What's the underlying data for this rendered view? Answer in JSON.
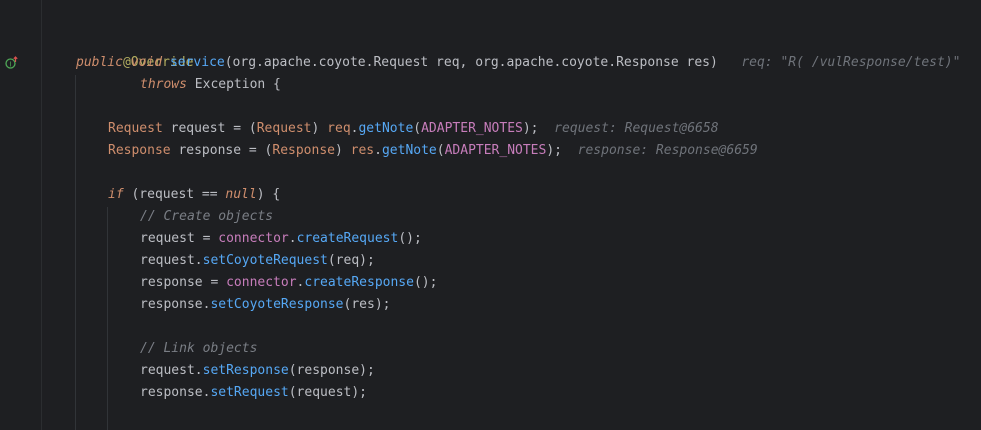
{
  "editor": {
    "colors": {
      "background": "#1e1f22",
      "annotation": "#b3ae60",
      "keyword": "#cf8e6d",
      "method": "#56a8f5",
      "field": "#c77dbb",
      "comment": "#7a7e85",
      "hint": "#6f737a",
      "text": "#bcbec4",
      "gutter_marker": "#4fa857"
    },
    "gutter_icon": "override-method-icon",
    "lines": {
      "l1": {
        "annotation": "@Override"
      },
      "l2": {
        "kw1": "public",
        "kw2": "void",
        "method": "service",
        "params": "(org.apache.coyote.Request req, org.apache.coyote.Response res)",
        "hint": "req: \"R( /vulResponse/test)\""
      },
      "l3": {
        "kw": "throws",
        "rest": " Exception {"
      },
      "l4": {
        "type": "Request",
        "decl": " request = (",
        "cast": "Request",
        "mid": ") ",
        "obj": "req",
        "dot": ".",
        "call": "getNote",
        "open": "(",
        "const": "ADAPTER_NOTES",
        "close": ");",
        "hint": "request: Request@6658"
      },
      "l5": {
        "type": "Response",
        "decl": " response = (",
        "cast": "Response",
        "mid": ") ",
        "obj": "res",
        "dot": ".",
        "call": "getNote",
        "open": "(",
        "const": "ADAPTER_NOTES",
        "close": ");",
        "hint": "response: Response@6659"
      },
      "l6": {
        "kw": "if",
        "pre": " (request == ",
        "nul": "null",
        "post": ") {"
      },
      "l7": {
        "comment": "// Create objects"
      },
      "l8": {
        "a": "request = ",
        "obj": "connector",
        "dot": ".",
        "call": "createRequest",
        "end": "();"
      },
      "l9": {
        "a": "request.",
        "call": "setCoyoteRequest",
        "end": "(req);"
      },
      "l10": {
        "a": "response = ",
        "obj": "connector",
        "dot": ".",
        "call": "createResponse",
        "end": "();"
      },
      "l11": {
        "a": "response.",
        "call": "setCoyoteResponse",
        "end": "(res);"
      },
      "l12": {
        "comment": "// Link objects"
      },
      "l13": {
        "a": "request.",
        "call": "setResponse",
        "end": "(response);"
      },
      "l14": {
        "a": "response.",
        "call": "setRequest",
        "end": "(request);"
      }
    }
  }
}
